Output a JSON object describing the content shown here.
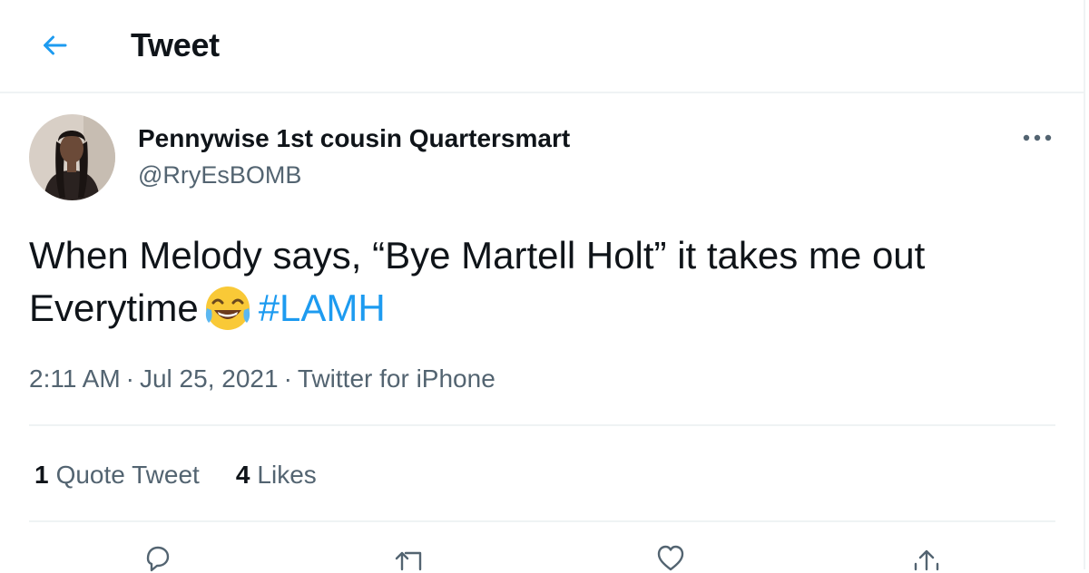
{
  "header": {
    "back_icon": "arrow-left-icon",
    "title": "Tweet"
  },
  "tweet": {
    "author": {
      "display_name": "Pennywise 1st cousin Quartersmart",
      "handle": "@RryEsBOMB"
    },
    "more_icon": "more-horizontal-icon",
    "text": {
      "line1": "When Melody says, “Bye Martell Holt” it takes me out",
      "line2_prefix": "Everytime",
      "emoji": "face-with-tears-of-joy",
      "hashtag": "#LAMH"
    },
    "meta": {
      "time": "2:11 AM",
      "separator": "·",
      "date": "Jul 25, 2021",
      "source": "Twitter for iPhone"
    },
    "stats": {
      "quotes_count": "1",
      "quotes_label": "Quote Tweet",
      "likes_count": "4",
      "likes_label": "Likes"
    },
    "actions": {
      "reply_icon": "reply-icon",
      "retweet_icon": "retweet-icon",
      "like_icon": "heart-icon",
      "share_icon": "share-icon"
    }
  },
  "colors": {
    "accent": "#1d9bf0",
    "text_primary": "#0f1419",
    "text_secondary": "#536471",
    "divider": "#eff3f4"
  }
}
